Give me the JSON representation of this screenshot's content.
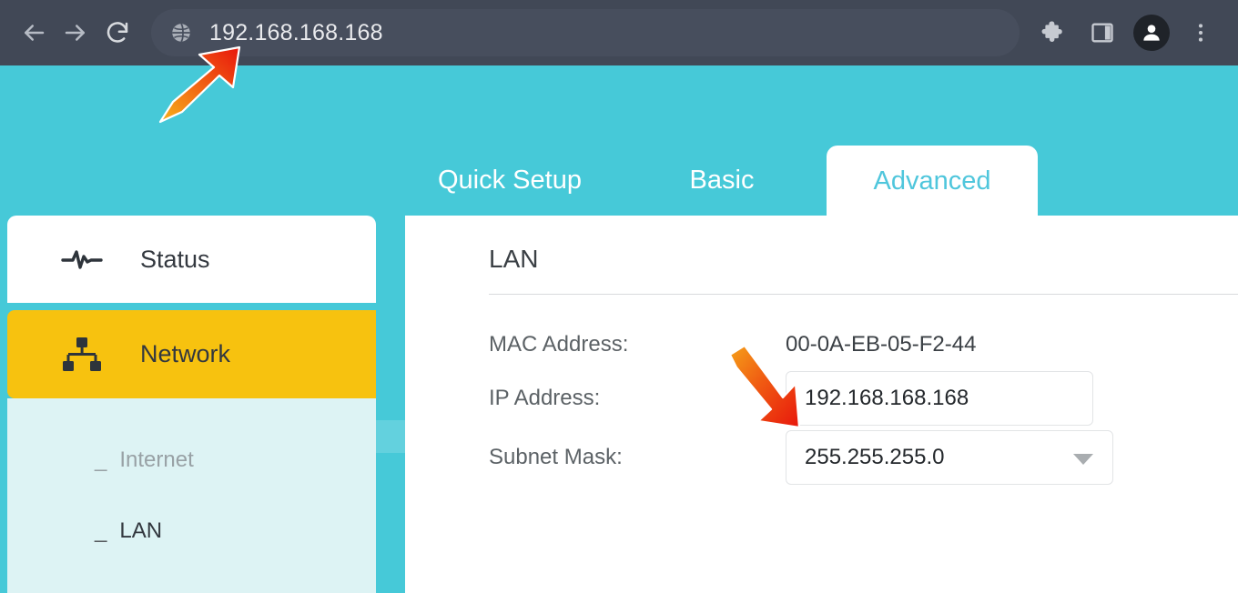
{
  "browser": {
    "back_icon": "back-arrow-icon",
    "forward_icon": "forward-arrow-icon",
    "reload_icon": "reload-icon",
    "site_icon": "globe-icon",
    "address_value": "192.168.168.168",
    "address_placeholder": "Search Google or type a URL",
    "extensions_icon": "puzzle-piece-icon",
    "sidepanel_icon": "side-panel-icon",
    "profile_icon": "profile-avatar-icon",
    "menu_icon": "three-dot-menu-icon"
  },
  "theme": {
    "teal": "#46c9d8",
    "teal_light": "#ddf3f4",
    "yellow": "#f7c20f",
    "chrome_dark": "#414856",
    "accent_text": "#4fc6dc",
    "arrow_start": "#f5a623",
    "arrow_end": "#e8170c"
  },
  "tabs": [
    {
      "label": "Quick Setup",
      "active": false
    },
    {
      "label": "Basic",
      "active": false
    },
    {
      "label": "Advanced",
      "active": true
    }
  ],
  "sidebar": {
    "items": [
      {
        "label": "Status",
        "icon": "pulse-icon",
        "active": false
      },
      {
        "label": "Network",
        "icon": "network-tree-icon",
        "active": true
      }
    ],
    "submenu": [
      {
        "label": "Internet",
        "dash": "_",
        "selected": false
      },
      {
        "label": "LAN",
        "dash": "_",
        "selected": true
      }
    ]
  },
  "content": {
    "section_title": "LAN",
    "fields": {
      "mac": {
        "label": "MAC Address:",
        "value": "00-0A-EB-05-F2-44"
      },
      "ip": {
        "label": "IP Address:",
        "value": "192.168.168.168",
        "placeholder": ""
      },
      "subnet": {
        "label": "Subnet Mask:",
        "value": "255.255.255.0",
        "caret": "chevron-down-icon"
      }
    }
  },
  "annotations": [
    {
      "name": "arrow-to-address-bar",
      "target": "address-bar",
      "direction": "up-right"
    },
    {
      "name": "arrow-to-ip-field",
      "target": "ip-address-input",
      "direction": "down-right"
    }
  ]
}
